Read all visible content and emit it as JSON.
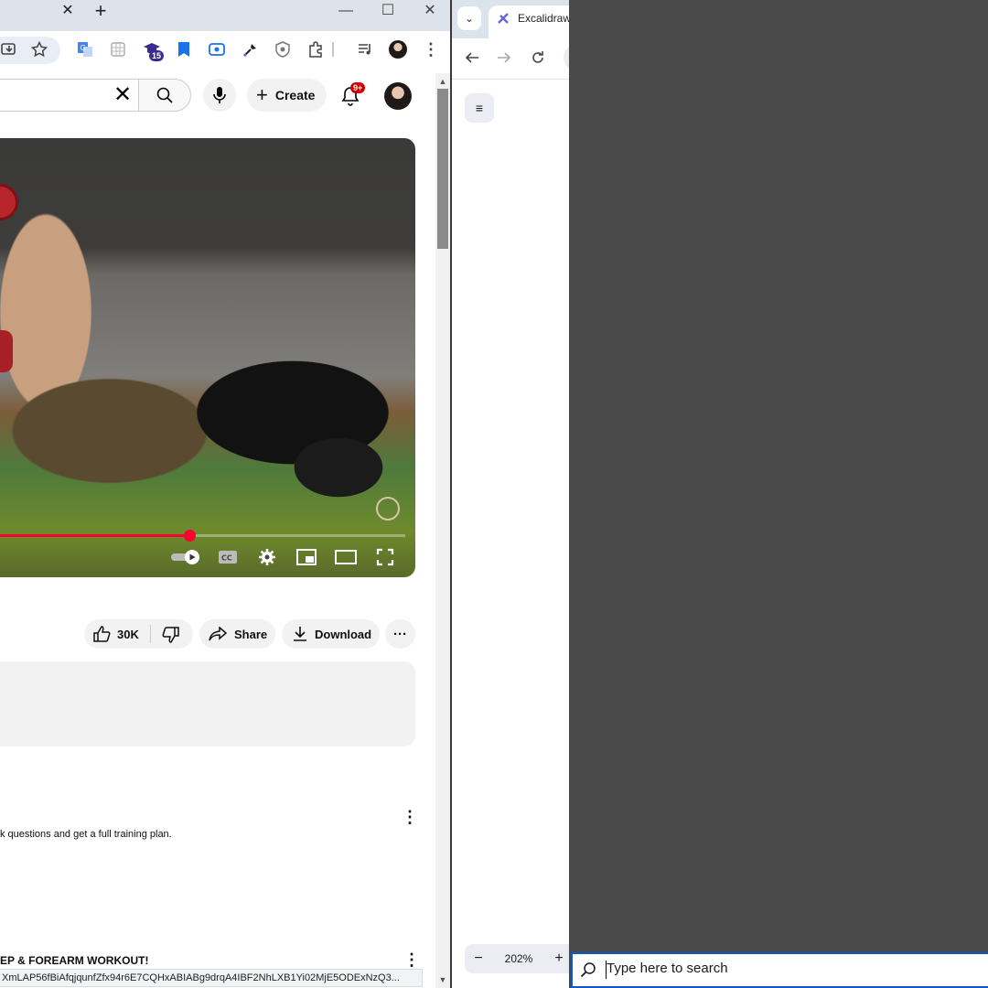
{
  "left_window": {
    "tab_close_glyph": "✕",
    "new_tab_glyph": "+",
    "window_controls": {
      "minimize": "—",
      "maximize": "☐",
      "close": "✕"
    },
    "extensions": {
      "badge_count": "15"
    },
    "youtube": {
      "search_clear_glyph": "✕",
      "create_label": "Create",
      "create_plus": "+",
      "notifications_badge": "9+",
      "player": {
        "progress_fraction": 0.49
      },
      "actions": {
        "like_count": "30K",
        "share_label": "Share",
        "download_label": "Download",
        "more_glyph": "···"
      },
      "comment_snippet": "k questions and get a full training plan.",
      "kebab_glyph": "⋮",
      "next_video_title": "EP & FOREARM WORKOUT!",
      "status_url": "XmLAP56fBiAfqjqunfZfx94r6E7CQHxABIABg9drqA4IBF2NhLXB1Yi02MjE5ODExNzQ3..."
    },
    "scrollbar": {
      "up_glyph": "▲",
      "down_glyph": "▼"
    }
  },
  "right_window": {
    "tab_search_glyph": "⌄",
    "tab_title": "Excalidraw",
    "menu_glyph": "≡",
    "zoom": {
      "minus": "−",
      "value": "202%",
      "plus": "+"
    }
  },
  "taskbar": {
    "search_placeholder": "Type here to search"
  },
  "colors": {
    "youtube_red": "#ff0033",
    "desktop_bg": "#4a4a4a",
    "taskbar_focus": "#0a59c4"
  }
}
